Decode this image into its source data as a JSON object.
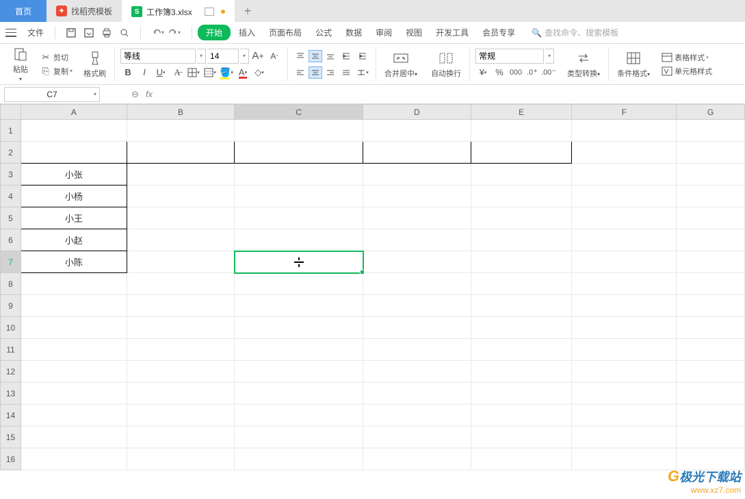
{
  "tabs": {
    "home": "首页",
    "template": "找稻壳模板",
    "doc": "工作簿3.xlsx",
    "doc_icon": "S"
  },
  "menu": {
    "file": "文件",
    "items": [
      "开始",
      "插入",
      "页面布局",
      "公式",
      "数据",
      "审阅",
      "视图",
      "开发工具",
      "会员专享"
    ],
    "search_placeholder": "查找命令、搜索模板"
  },
  "ribbon": {
    "paste": "粘贴",
    "cut": "剪切",
    "copy": "复制",
    "format_painter": "格式刷",
    "font_name": "等线",
    "font_size": "14",
    "merge_center": "合并居中",
    "auto_wrap": "自动换行",
    "number_format": "常规",
    "type_convert": "类型转换",
    "cond_format": "条件格式",
    "table_style": "表格样式",
    "cell_style": "单元格样式"
  },
  "cell_ref": "C7",
  "fx_label": "fx",
  "columns": [
    "A",
    "B",
    "C",
    "D",
    "E",
    "F",
    "G"
  ],
  "rows": [
    "1",
    "2",
    "3",
    "4",
    "5",
    "6",
    "7",
    "8",
    "9",
    "10",
    "11",
    "12",
    "13",
    "14",
    "15",
    "16"
  ],
  "cells": {
    "A3": "小张",
    "A4": "小杨",
    "A5": "小王",
    "A6": "小赵",
    "A7": "小陈"
  },
  "selected": "C7",
  "watermark": {
    "brand": "极光下载站",
    "url": "www.xz7.com"
  }
}
